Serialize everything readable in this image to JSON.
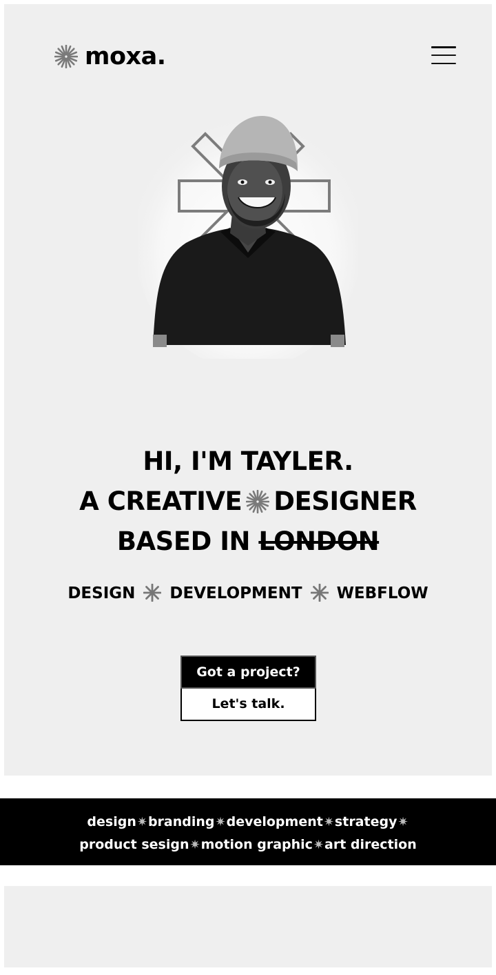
{
  "header": {
    "logo_text": "moxa.",
    "logo_icon": "sunburst-icon",
    "menu_icon": "hamburger-menu-icon"
  },
  "hero": {
    "portrait_alt": "Smiling man in beanie and black polo",
    "headline": {
      "line1": "HI, I'M TAYLER.",
      "line2_a": "A CREATIVE",
      "line2_b": "DESIGNER",
      "line3_a": "BASED IN",
      "line3_struck": "LONDON"
    },
    "services": [
      "DESIGN",
      "DEVELOPMENT",
      "WEBFLOW"
    ],
    "cta": {
      "primary_label": "Got a project?",
      "secondary_label": "Let's talk."
    }
  },
  "ticker": {
    "row1": [
      "design",
      "branding",
      "development",
      "strategy"
    ],
    "row2": [
      "product sesign",
      "motion graphic",
      "art direction"
    ],
    "separator": "✷"
  },
  "colors": {
    "background": "#ffffff",
    "panel": "#efefef",
    "ink": "#000000",
    "ticker_bg": "#000000",
    "ticker_text": "#ffffff"
  }
}
